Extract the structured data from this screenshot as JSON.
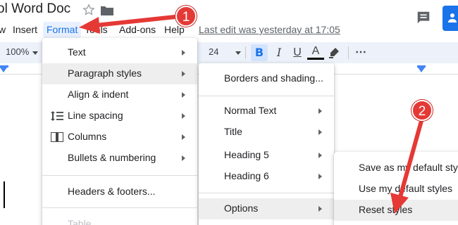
{
  "app": {
    "title": "ol Word Doc",
    "last_edit": "Last edit was yesterday at 17:05"
  },
  "menubar": [
    {
      "label": "w"
    },
    {
      "label": "Insert"
    },
    {
      "label": "Format"
    },
    {
      "label": "Tools"
    },
    {
      "label": "Add-ons"
    },
    {
      "label": "Help"
    }
  ],
  "toolbar": {
    "zoom": "100%",
    "font_size": "24",
    "bold": "B",
    "italic": "I",
    "underline": "U",
    "text_color": "A",
    "more": "⋯"
  },
  "format_menu": {
    "items": [
      {
        "label": "Text"
      },
      {
        "label": "Paragraph styles"
      },
      {
        "label": "Align & indent"
      },
      {
        "label": "Line spacing"
      },
      {
        "label": "Columns"
      },
      {
        "label": "Bullets & numbering"
      },
      {
        "label": "Headers & footers..."
      },
      {
        "label": "Table"
      }
    ]
  },
  "paragraph_styles_menu": {
    "items": [
      {
        "label": "Borders and shading..."
      },
      {
        "label": "Normal Text"
      },
      {
        "label": "Title"
      },
      {
        "label": "Heading 5"
      },
      {
        "label": "Heading 6"
      },
      {
        "label": "Options"
      }
    ]
  },
  "options_menu": {
    "items": [
      {
        "label": "Save as my default styles"
      },
      {
        "label": "Use my default styles"
      },
      {
        "label": "Reset styles"
      }
    ]
  },
  "annotations": {
    "step1": "1",
    "step2": "2"
  },
  "colors": {
    "accent": "#1a73e8",
    "annotation": "#e53935",
    "menu_hover": "#eeeeee"
  }
}
